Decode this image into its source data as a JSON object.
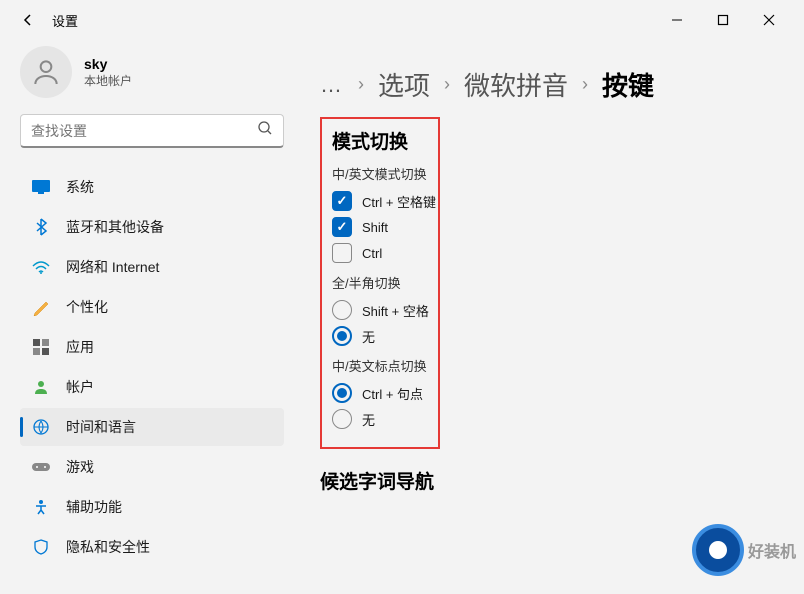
{
  "window": {
    "title": "设置",
    "min_icon": "—",
    "max_icon": "□",
    "close_icon": "✕"
  },
  "user": {
    "name": "sky",
    "type": "本地帐户"
  },
  "search": {
    "placeholder": "查找设置"
  },
  "nav": [
    {
      "icon": "system",
      "label": "系统"
    },
    {
      "icon": "bluetooth",
      "label": "蓝牙和其他设备"
    },
    {
      "icon": "network",
      "label": "网络和 Internet"
    },
    {
      "icon": "personalize",
      "label": "个性化"
    },
    {
      "icon": "apps",
      "label": "应用"
    },
    {
      "icon": "account",
      "label": "帐户"
    },
    {
      "icon": "timelang",
      "label": "时间和语言"
    },
    {
      "icon": "gaming",
      "label": "游戏"
    },
    {
      "icon": "accessibility",
      "label": "辅助功能"
    },
    {
      "icon": "privacy",
      "label": "隐私和安全性"
    }
  ],
  "breadcrumb": {
    "dots": "…",
    "items": [
      "选项",
      "微软拼音"
    ],
    "current": "按键"
  },
  "sections": {
    "mode_switch": {
      "title": "模式切换",
      "cn_en_mode": {
        "label": "中/英文模式切换",
        "opt1": {
          "label": "Ctrl + 空格键",
          "checked": true
        },
        "opt2": {
          "label": "Shift",
          "checked": true
        },
        "opt3": {
          "label": "Ctrl",
          "checked": false
        }
      },
      "full_half": {
        "label": "全/半角切换",
        "opt1": {
          "label": "Shift + 空格",
          "selected": false
        },
        "opt2": {
          "label": "无",
          "selected": true
        }
      },
      "punct": {
        "label": "中/英文标点切换",
        "opt1": {
          "label": "Ctrl + 句点",
          "selected": true
        },
        "opt2": {
          "label": "无",
          "selected": false
        }
      }
    },
    "candidate_nav": {
      "title": "候选字词导航"
    }
  },
  "watermark": {
    "text": "好装机"
  }
}
